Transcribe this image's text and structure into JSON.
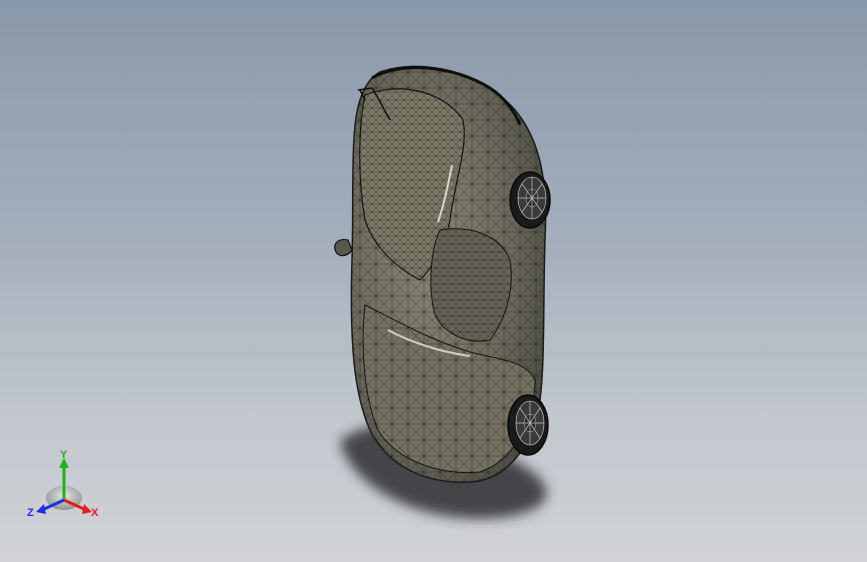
{
  "viewport": {
    "background_top": "#8a98ab",
    "background_bottom": "#d0d2d6"
  },
  "model": {
    "name": "car-body-mesh",
    "display_style": "shaded-with-edges",
    "body_color": "#6e6b5e",
    "edge_color": "#1a1a18",
    "shadow_color": "#2e2e30"
  },
  "triad": {
    "x_label": "X",
    "y_label": "Y",
    "z_label": "Z",
    "x_color": "#e02020",
    "y_color": "#20b020",
    "z_color": "#2030e0"
  }
}
